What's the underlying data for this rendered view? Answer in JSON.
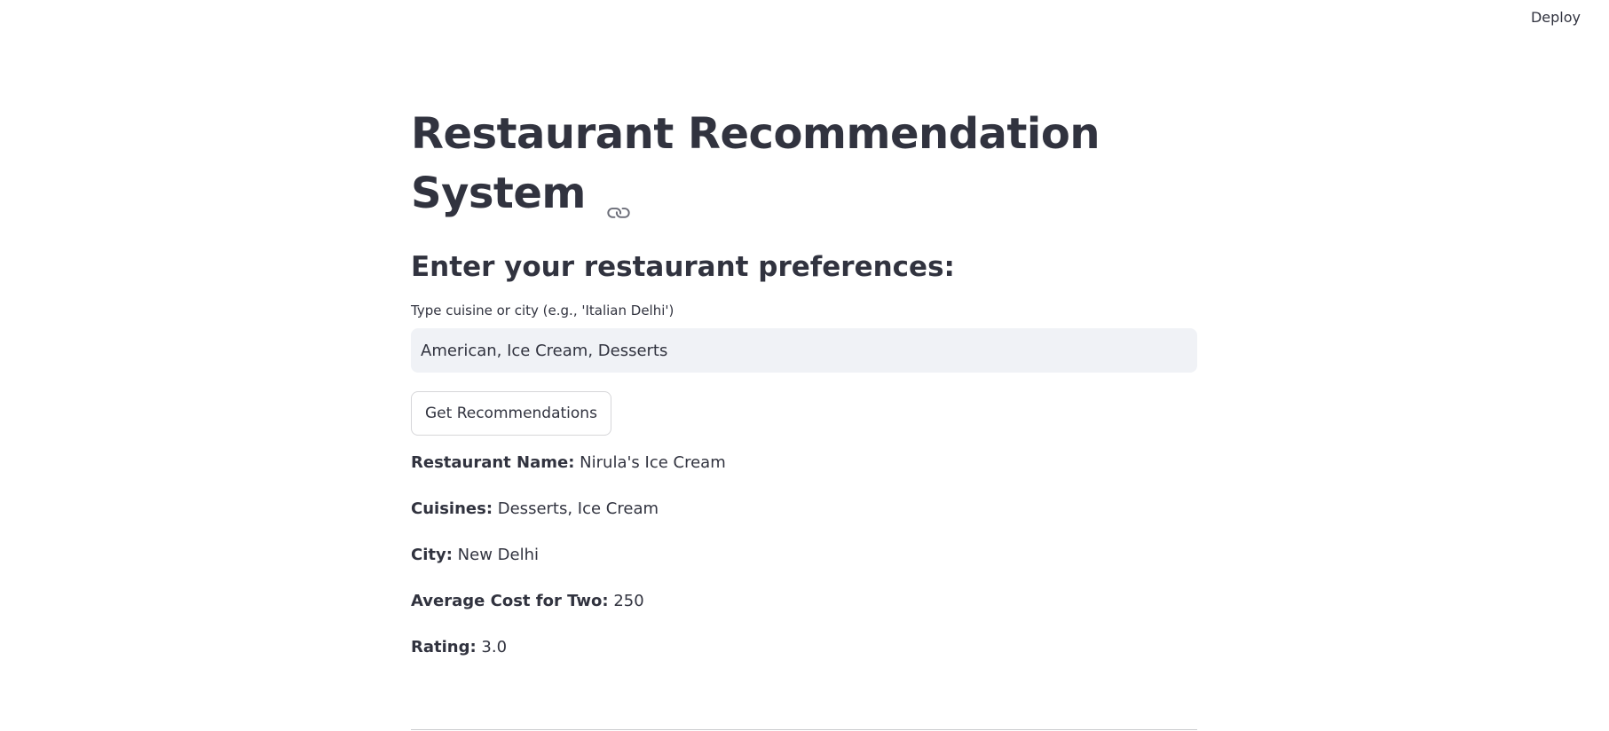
{
  "header": {
    "deploy_label": "Deploy"
  },
  "main": {
    "title_line1": "Restaurant Recommendation",
    "title_line2": "System",
    "subheader": "Enter your restaurant preferences:",
    "input": {
      "label": "Type cuisine or city (e.g., 'Italian Delhi')",
      "value": "American, Ice Cream, Desserts"
    },
    "button_label": "Get Recommendations",
    "results": [
      {
        "label": "Restaurant Name:",
        "value": "Nirula's Ice Cream"
      },
      {
        "label": "Cuisines:",
        "value": "Desserts, Ice Cream"
      },
      {
        "label": "City:",
        "value": "New Delhi"
      },
      {
        "label": "Average Cost for Two:",
        "value": "250"
      },
      {
        "label": "Rating:",
        "value": "3.0"
      }
    ]
  },
  "icons": {
    "anchor": "link-icon"
  }
}
